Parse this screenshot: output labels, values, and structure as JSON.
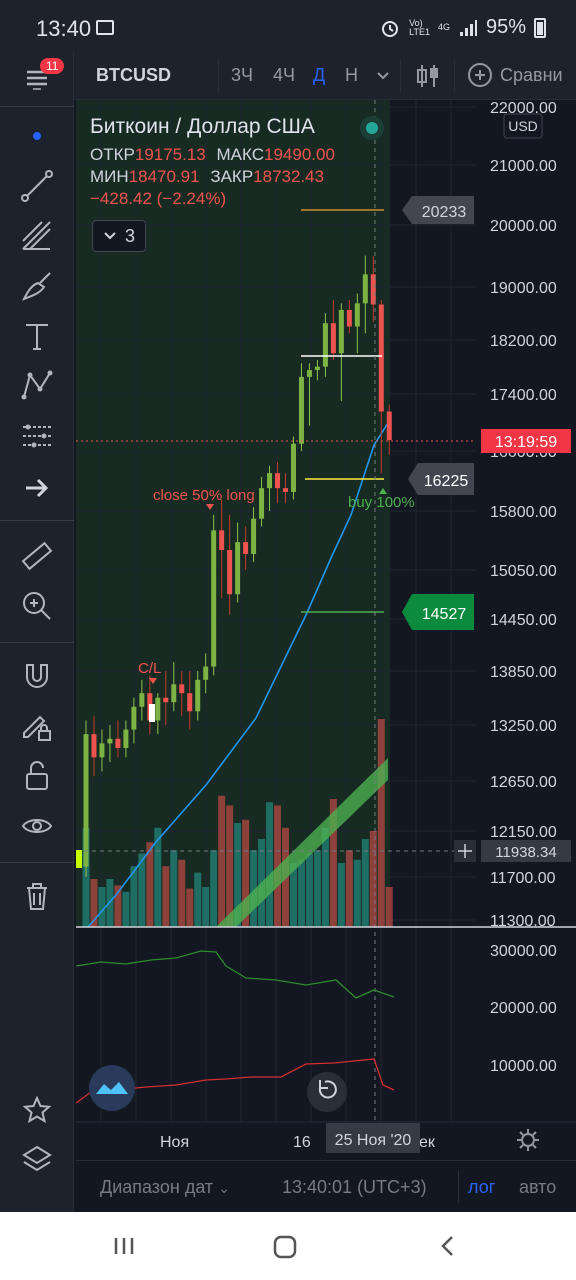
{
  "status": {
    "time": "13:40",
    "signal_top": "Vo)",
    "signal_bottom": "LTE1",
    "net": "4G",
    "battery": "95%"
  },
  "toolbar": {
    "symbol": "BTCUSD",
    "timeframes": [
      "3Ч",
      "4Ч",
      "Д",
      "Н"
    ],
    "active_timeframe": "Д",
    "compare_label": "Сравни"
  },
  "sidebar": {
    "badge": "11",
    "tools": [
      "menu-icon",
      "dot-icon",
      "trend-line-icon",
      "fib-icon",
      "brush-icon",
      "text-icon",
      "pattern-icon",
      "prediction-icon",
      "arrow-icon",
      "ruler-icon",
      "zoom-in-icon",
      "magnet-icon",
      "lock-drawing-icon",
      "unlock-icon",
      "eye-icon",
      "trash-icon",
      "star-icon",
      "layers-icon"
    ]
  },
  "legend": {
    "title": "Биткоин / Доллар США",
    "open_label": "ОТКР",
    "open_value": "19175.13",
    "high_label": "МАКС",
    "high_value": "19490.00",
    "low_label": "МИН",
    "low_value": "18470.91",
    "close_label": "ЗАКР",
    "close_value": "18732.43",
    "change": "−428.42 (−2.24%)",
    "indicators_count": "3",
    "currency": "USD"
  },
  "colors": {
    "up": "#7cb342",
    "down": "#ef5350",
    "bg": "#131722",
    "accent": "#2962ff",
    "ma": "#2196f3"
  },
  "chart_data": {
    "type": "candlestick",
    "symbol": "BTCUSD",
    "interval": "1D",
    "price_axis": [
      "22000.00",
      "21000.00",
      "20000.00",
      "19000.00",
      "18200.00",
      "17400.00",
      "16600.00",
      "15800.00",
      "15050.00",
      "14450.00",
      "13850.00",
      "13250.00",
      "12650.00",
      "12150.00",
      "11700.00",
      "11300.00"
    ],
    "ylim": [
      11300,
      22000
    ],
    "scale": "log",
    "time_axis": [
      "Ноя",
      "16",
      "25 Ноя '20",
      "ек"
    ],
    "crosshair_date": "25 Ноя '20",
    "crosshair_price": "11938.34",
    "last_price": "13:19:59",
    "markers": [
      {
        "price": "20233",
        "color": "#434651"
      },
      {
        "price": "16225",
        "color": "#434651"
      },
      {
        "price": "14527",
        "color": "#0c8a3e"
      }
    ],
    "annotations": [
      "close 50% long",
      "C/L",
      "buy 100%"
    ],
    "candles": [
      {
        "o": 11800,
        "h": 13300,
        "l": 11700,
        "c": 13150
      },
      {
        "o": 13150,
        "h": 13350,
        "l": 12700,
        "c": 12900
      },
      {
        "o": 12900,
        "h": 13200,
        "l": 12750,
        "c": 13050
      },
      {
        "o": 13050,
        "h": 13250,
        "l": 12850,
        "c": 13100
      },
      {
        "o": 13100,
        "h": 13300,
        "l": 12900,
        "c": 13000
      },
      {
        "o": 13000,
        "h": 13300,
        "l": 12900,
        "c": 13200
      },
      {
        "o": 13200,
        "h": 13550,
        "l": 13050,
        "c": 13450
      },
      {
        "o": 13450,
        "h": 13750,
        "l": 13300,
        "c": 13600
      },
      {
        "o": 13600,
        "h": 13800,
        "l": 13150,
        "c": 13300
      },
      {
        "o": 13300,
        "h": 13600,
        "l": 13150,
        "c": 13550
      },
      {
        "o": 13550,
        "h": 13850,
        "l": 13250,
        "c": 13500
      },
      {
        "o": 13500,
        "h": 13950,
        "l": 13400,
        "c": 13700
      },
      {
        "o": 13700,
        "h": 13850,
        "l": 13350,
        "c": 13600
      },
      {
        "o": 13600,
        "h": 13850,
        "l": 13200,
        "c": 13400
      },
      {
        "o": 13400,
        "h": 13850,
        "l": 13300,
        "c": 13750
      },
      {
        "o": 13750,
        "h": 14050,
        "l": 13600,
        "c": 13900
      },
      {
        "o": 13900,
        "h": 15750,
        "l": 13800,
        "c": 15550
      },
      {
        "o": 15550,
        "h": 15950,
        "l": 14700,
        "c": 15300
      },
      {
        "o": 15300,
        "h": 15750,
        "l": 14500,
        "c": 14750
      },
      {
        "o": 14750,
        "h": 15650,
        "l": 14650,
        "c": 15400
      },
      {
        "o": 15400,
        "h": 15600,
        "l": 15050,
        "c": 15250
      },
      {
        "o": 15250,
        "h": 15850,
        "l": 15150,
        "c": 15700
      },
      {
        "o": 15700,
        "h": 16250,
        "l": 15600,
        "c": 16100
      },
      {
        "o": 16100,
        "h": 16400,
        "l": 15800,
        "c": 16300
      },
      {
        "o": 16300,
        "h": 16450,
        "l": 15900,
        "c": 16100
      },
      {
        "o": 16100,
        "h": 16300,
        "l": 15900,
        "c": 16050
      },
      {
        "o": 16050,
        "h": 16800,
        "l": 15950,
        "c": 16700
      },
      {
        "o": 16700,
        "h": 17850,
        "l": 16600,
        "c": 17650
      },
      {
        "o": 17650,
        "h": 17850,
        "l": 16950,
        "c": 17750
      },
      {
        "o": 17750,
        "h": 17900,
        "l": 17600,
        "c": 17800
      },
      {
        "o": 17800,
        "h": 18600,
        "l": 17650,
        "c": 18450
      },
      {
        "o": 18450,
        "h": 18800,
        "l": 17900,
        "c": 18000
      },
      {
        "o": 18000,
        "h": 18750,
        "l": 17300,
        "c": 18650
      },
      {
        "o": 18650,
        "h": 18800,
        "l": 18300,
        "c": 18400
      },
      {
        "o": 18400,
        "h": 18900,
        "l": 18000,
        "c": 18750
      },
      {
        "o": 18750,
        "h": 19500,
        "l": 18300,
        "c": 19200
      },
      {
        "o": 19200,
        "h": 19490,
        "l": 18470,
        "c": 18732
      },
      {
        "o": 18732,
        "h": 18800,
        "l": 16300,
        "c": 17150
      },
      {
        "o": 17150,
        "h": 17250,
        "l": 16550,
        "c": 16750
      }
    ],
    "volume": [
      62,
      30,
      25,
      30,
      26,
      22,
      38,
      46,
      53,
      62,
      38,
      48,
      42,
      24,
      34,
      25,
      48,
      82,
      76,
      65,
      67,
      48,
      55,
      78,
      76,
      62,
      40,
      42,
      46,
      48,
      62,
      80,
      40,
      48,
      42,
      55,
      60,
      130,
      25
    ],
    "indicator1_axis": [
      "30000.00",
      "20000.00"
    ],
    "indicator2_axis": [
      "10000.00"
    ]
  },
  "bottom": {
    "range_label": "Диапазон дат",
    "clock": "13:40:01 (UTC+3)",
    "log": "лог",
    "auto": "авто"
  }
}
